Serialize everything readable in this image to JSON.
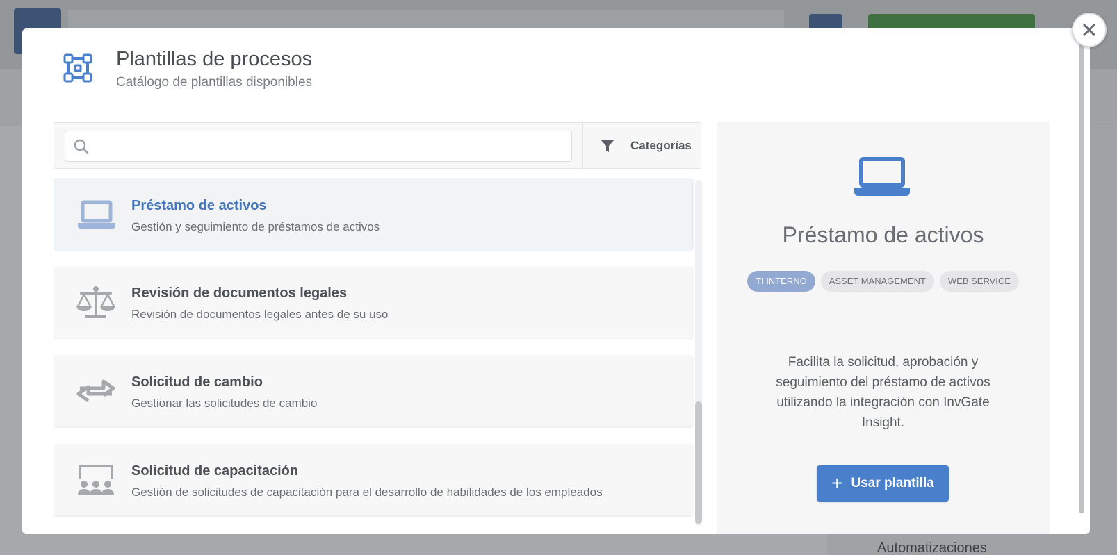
{
  "background": {
    "side_item": "Automatizaciones"
  },
  "modal": {
    "title": "Plantillas de procesos",
    "subtitle": "Catálogo de plantillas disponibles",
    "close_icon": "close-icon"
  },
  "search": {
    "placeholder": "",
    "value": "",
    "categories_label": "Categorías"
  },
  "templates": [
    {
      "title": "Préstamo de activos",
      "description": "Gestión y seguimiento de préstamos de activos",
      "icon": "laptop-icon",
      "selected": true
    },
    {
      "title": "Revisión de documentos legales",
      "description": "Revisión de documentos legales antes de su uso",
      "icon": "scale-icon",
      "selected": false
    },
    {
      "title": "Solicitud de cambio",
      "description": "Gestionar las solicitudes de cambio",
      "icon": "exchange-arrows-icon",
      "selected": false
    },
    {
      "title": "Solicitud de capacitación",
      "description": "Gestión de solicitudes de capacitación para el desarrollo de habilidades de los empleados",
      "icon": "classroom-icon",
      "selected": false
    }
  ],
  "detail": {
    "title": "Préstamo de activos",
    "tags": [
      "TI INTERNO",
      "ASSET MANAGEMENT",
      "WEB SERVICE"
    ],
    "description": "Facilita la solicitud, aprobación y seguimiento del préstamo de activos utilizando la integración con InvGate Insight.",
    "button_label": "Usar plantilla"
  },
  "colors": {
    "accent": "#4a7fcb",
    "selected_title": "#4576b7",
    "tag_primary": "#92a9d2"
  }
}
